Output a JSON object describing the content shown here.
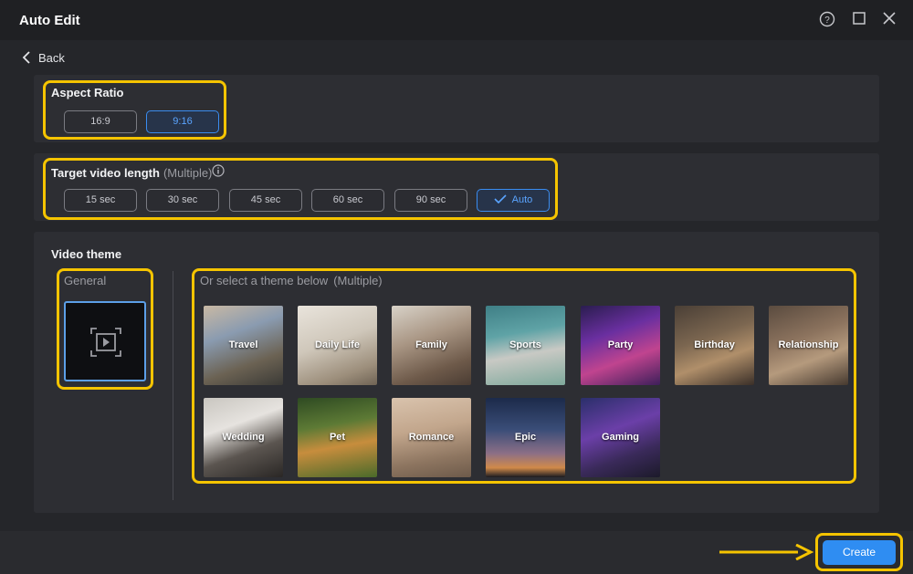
{
  "window": {
    "title": "Auto Edit",
    "controls": [
      "help-icon",
      "maximize-icon",
      "close-icon"
    ]
  },
  "nav": {
    "back_label": "Back"
  },
  "aspect_ratio": {
    "label": "Aspect Ratio",
    "options": [
      "16:9",
      "9:16"
    ],
    "selected": "9:16"
  },
  "target_length": {
    "label": "Target video length",
    "sub_label": "(Multiple)",
    "options": [
      "15 sec",
      "30 sec",
      "45 sec",
      "60 sec",
      "90 sec",
      "Auto"
    ],
    "selected": "Auto"
  },
  "video_theme": {
    "label": "Video theme",
    "general_label": "General",
    "select_label": "Or select a theme below",
    "select_sub": "(Multiple)",
    "themes": [
      "Travel",
      "Daily Life",
      "Family",
      "Sports",
      "Party",
      "Birthday",
      "Relationship",
      "Wedding",
      "Pet",
      "Romance",
      "Epic",
      "Gaming"
    ]
  },
  "footer": {
    "create_label": "Create"
  },
  "colors": {
    "accent": "#2f8df2",
    "highlight": "#f5c400",
    "selected_text": "#5aa4ff"
  }
}
